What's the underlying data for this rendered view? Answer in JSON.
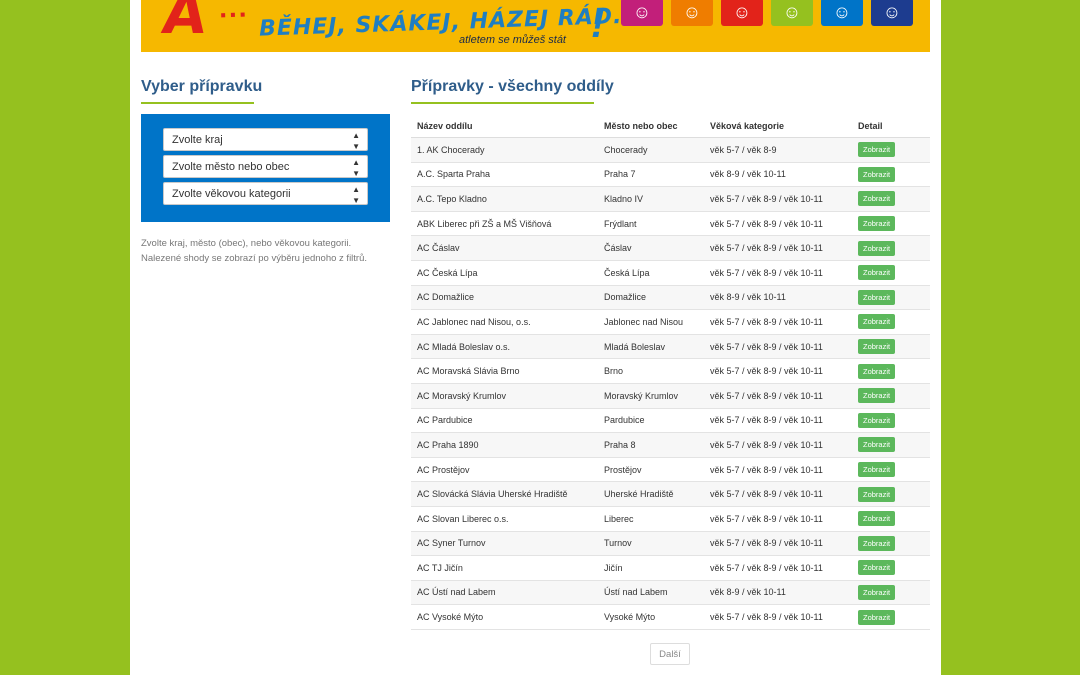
{
  "banner": {
    "logo_letter": "A",
    "logo_text": "...",
    "slogan": "BĚHEJ, SKÁKEJ, HÁZEJ RÁD...",
    "tagline": "atletem se můžeš stát",
    "exclaim": "!",
    "tiles": [
      {
        "color": "#c21f7a",
        "icon": "figure-icon"
      },
      {
        "color": "#ef7d00",
        "icon": "figure-icon"
      },
      {
        "color": "#e2231a",
        "icon": "figure-icon"
      },
      {
        "color": "#95c11f",
        "icon": "figure-icon"
      },
      {
        "color": "#0074c8",
        "icon": "figure-icon"
      },
      {
        "color": "#1d3c8f",
        "icon": "figure-icon"
      }
    ]
  },
  "filters": {
    "heading": "Vyber přípravku",
    "region": "Zvolte kraj",
    "city": "Zvolte město nebo obec",
    "age": "Zvolte věkovou kategorii",
    "hint": "Zvolte kraj, město (obec), nebo věkovou kategorii. Nalezené shody se zobrazí po výběru jednoho z filtrů."
  },
  "results": {
    "heading": "Přípravky - všechny oddíly",
    "columns": [
      "Název oddílu",
      "Město nebo obec",
      "Věková kategorie",
      "Detail"
    ],
    "button_label": "Zobrazit",
    "rows": [
      [
        "1. AK Chocerady",
        "Chocerady",
        "věk 5-7 / věk 8-9"
      ],
      [
        "A.C. Sparta Praha",
        "Praha 7",
        "věk 8-9 / věk 10-11"
      ],
      [
        "A.C. Tepo Kladno",
        "Kladno IV",
        "věk 5-7 / věk 8-9 / věk 10-11"
      ],
      [
        "ABK Liberec při ZŠ a MŠ Višňová",
        "Frýdlant",
        "věk 5-7 / věk 8-9 / věk 10-11"
      ],
      [
        "AC Čáslav",
        "Čáslav",
        "věk 5-7 / věk 8-9 / věk 10-11"
      ],
      [
        "AC Česká Lípa",
        "Česká Lípa",
        "věk 5-7 / věk 8-9 / věk 10-11"
      ],
      [
        "AC Domažlice",
        "Domažlice",
        "věk 8-9 / věk 10-11"
      ],
      [
        "AC Jablonec nad Nisou, o.s.",
        "Jablonec nad Nisou",
        "věk 5-7 / věk 8-9 / věk 10-11"
      ],
      [
        "AC Mladá Boleslav o.s.",
        "Mladá Boleslav",
        "věk 5-7 / věk 8-9 / věk 10-11"
      ],
      [
        "AC Moravská Slávia Brno",
        "Brno",
        "věk 5-7 / věk 8-9 / věk 10-11"
      ],
      [
        "AC Moravský Krumlov",
        "Moravský Krumlov",
        "věk 5-7 / věk 8-9 / věk 10-11"
      ],
      [
        "AC Pardubice",
        "Pardubice",
        "věk 5-7 / věk 8-9 / věk 10-11"
      ],
      [
        "AC Praha 1890",
        "Praha 8",
        "věk 5-7 / věk 8-9 / věk 10-11"
      ],
      [
        "AC Prostějov",
        "Prostějov",
        "věk 5-7 / věk 8-9 / věk 10-11"
      ],
      [
        "AC Slovácká Slávia Uherské Hradiště",
        "Uherské Hradiště",
        "věk 5-7 / věk 8-9 / věk 10-11"
      ],
      [
        "AC Slovan Liberec o.s.",
        "Liberec",
        "věk 5-7 / věk 8-9 / věk 10-11"
      ],
      [
        "AC Syner Turnov",
        "Turnov",
        "věk 5-7 / věk 8-9 / věk 10-11"
      ],
      [
        "AC TJ Jičín",
        "Jičín",
        "věk 5-7 / věk 8-9 / věk 10-11"
      ],
      [
        "AC Ústí nad Labem",
        "Ústí nad Labem",
        "věk 8-9 / věk 10-11"
      ],
      [
        "AC Vysoké Mýto",
        "Vysoké Mýto",
        "věk 5-7 / věk 8-9 / věk 10-11"
      ]
    ]
  },
  "pager": {
    "next_label": "Další"
  }
}
